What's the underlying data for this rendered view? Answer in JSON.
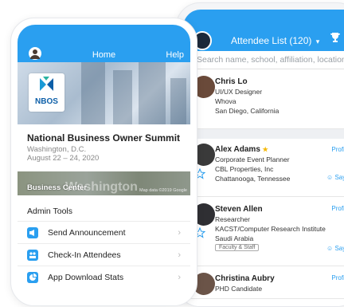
{
  "attendee_list": {
    "title": "Attendee List (120)",
    "title_caret": "▾",
    "search_placeholder": "Search name, school, affiliation, location",
    "profile_label": "Profile",
    "say_hi_label": "Say Hi",
    "attendees": [
      {
        "name": "Chris Lo",
        "lines": [
          "UI/UX Designer",
          "Whova",
          "San Diego, California"
        ]
      },
      {
        "name": "Alex Adams",
        "badge": "★",
        "lines": [
          "Corporate Event Planner",
          "CBL Properties, Inc",
          "Chattanooga, Tennessee"
        ]
      },
      {
        "name": "Steven Allen",
        "lines": [
          "Researcher",
          "KACST/Computer Research Institute",
          "Saudi Arabia"
        ],
        "tag": "Faculty & Staff"
      },
      {
        "name": "Christina Aubry",
        "lines": [
          "PHD Candidate"
        ]
      }
    ]
  },
  "home": {
    "header_title": "Home",
    "help_label": "Help",
    "logo_text": "NBOS",
    "event_title": "National Business Owner Summit",
    "event_location": "Washington, D.C.",
    "event_dates": "August 22 – 24, 2020",
    "map_label": "Business Center",
    "map_city_text": "Washington",
    "map_credit": "Map data ©2019 Google",
    "admin_tools_title": "Admin Tools",
    "admin_tools": [
      {
        "label": "Send Announcement",
        "icon": "megaphone-icon"
      },
      {
        "label": "Check-In Attendees",
        "icon": "people-icon"
      },
      {
        "label": "App Download Stats",
        "icon": "pie-chart-icon"
      }
    ]
  },
  "colors": {
    "accent": "#2a9ff0",
    "background": "#ffffff"
  }
}
